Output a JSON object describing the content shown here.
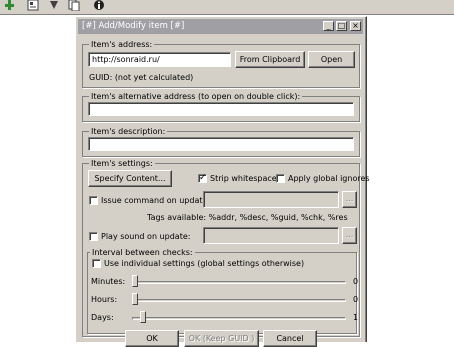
{
  "toolbar": {
    "icons": [
      "add-icon",
      "properties-icon",
      "refresh-icon",
      "copy-icon",
      "info-icon"
    ]
  },
  "dialog": {
    "title": "[#] Add/Modify item [#]",
    "title_buttons": {
      "minimize": "_",
      "maximize": "□",
      "close": "×"
    },
    "address": {
      "group_label": "Item's address:",
      "value": "http://sonraid.ru/",
      "from_clipboard_label": "From Clipboard",
      "open_label": "Open",
      "guid_text": "GUID: (not yet calculated)"
    },
    "alt_address": {
      "group_label": "Item's alternative address (to open on double click):",
      "value": ""
    },
    "description": {
      "group_label": "Item's description:",
      "value": ""
    },
    "settings": {
      "group_label": "Item's settings:",
      "specify_content_label": "Specify Content...",
      "strip_whitespaces_label": "Strip whitespaces",
      "strip_whitespaces_checked": true,
      "apply_global_ignores_label": "Apply global ignores",
      "apply_global_ignores_checked": false,
      "issue_command_label": "Issue command on update:",
      "issue_command_checked": false,
      "browse_label": "...",
      "tags_available": "Tags available: %addr, %desc, %guid, %chk, %res",
      "play_sound_label": "Play sound on update:",
      "play_sound_checked": false,
      "browse_sound_label": "..."
    },
    "interval": {
      "group_label": "Interval between checks:",
      "use_individual_label": "Use individual settings (global settings otherwise)",
      "use_individual_checked": false,
      "minutes_label": "Minutes:",
      "minutes_value": "0",
      "minutes_level": 0,
      "hours_label": "Hours:",
      "hours_value": "0",
      "hours_level": 0,
      "days_label": "Days:",
      "days_value": "1",
      "days_level": 0.04
    },
    "buttons": {
      "ok": "OK",
      "ok_keep_guid": "OK (Keep GUID )",
      "cancel": "Cancel"
    }
  }
}
